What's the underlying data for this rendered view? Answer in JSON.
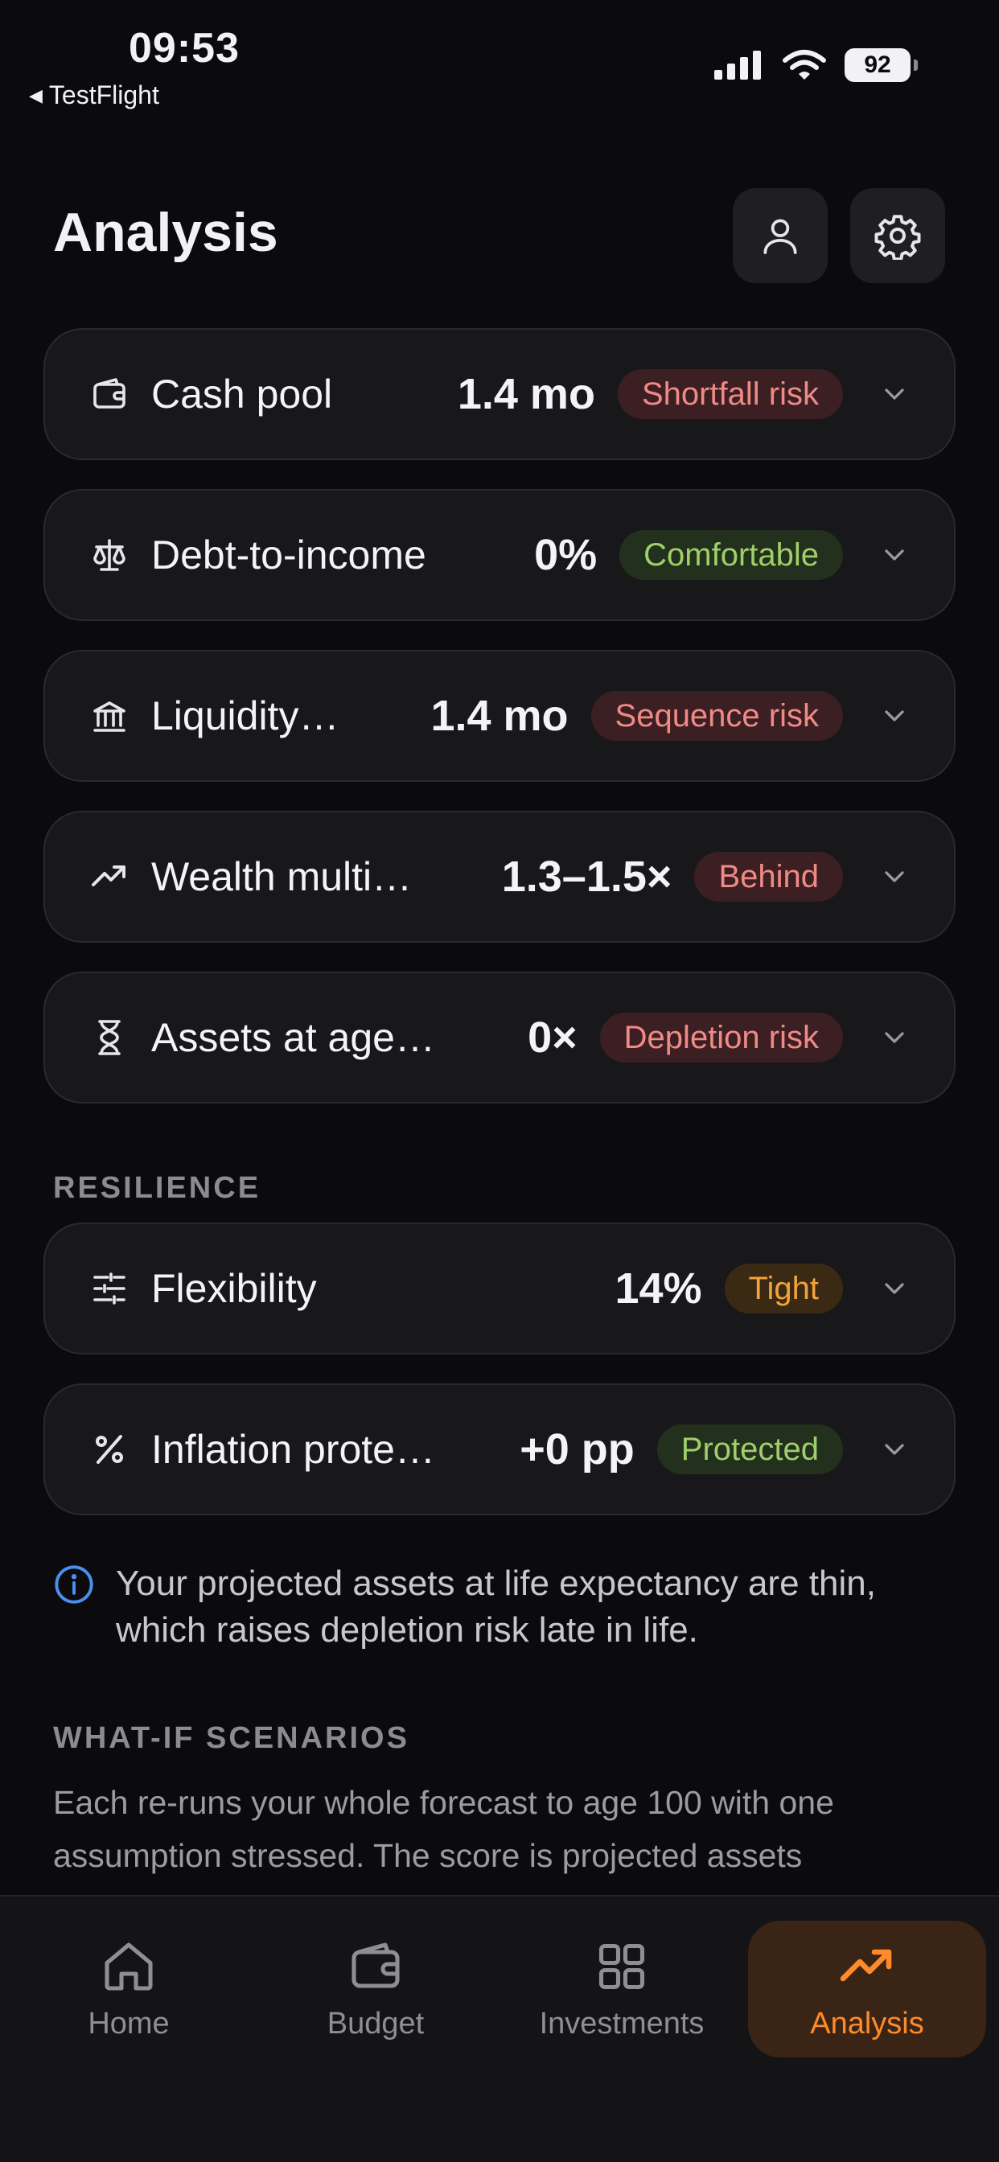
{
  "status_bar": {
    "time": "09:53",
    "back_app": "TestFlight",
    "battery": "92"
  },
  "header": {
    "title": "Analysis"
  },
  "metrics": [
    {
      "icon": "wallet-icon",
      "label": "Cash pool",
      "value": "1.4 mo",
      "status": "Shortfall risk",
      "tone": "red"
    },
    {
      "icon": "scale-icon",
      "label": "Debt-to-income",
      "value": "0%",
      "status": "Comfortable",
      "tone": "green"
    },
    {
      "icon": "bank-icon",
      "label": "Liquidity…",
      "value": "1.4 mo",
      "status": "Sequence risk",
      "tone": "red"
    },
    {
      "icon": "trend-up-icon",
      "label": "Wealth multi…",
      "value": "1.3–1.5×",
      "status": "Behind",
      "tone": "red"
    },
    {
      "icon": "hourglass-icon",
      "label": "Assets at age…",
      "value": "0×",
      "status": "Depletion risk",
      "tone": "red"
    }
  ],
  "resilience": {
    "section_label": "RESILIENCE",
    "items": [
      {
        "icon": "sliders-icon",
        "label": "Flexibility",
        "value": "14%",
        "status": "Tight",
        "tone": "amber"
      },
      {
        "icon": "percent-icon",
        "label": "Inflation prote…",
        "value": "+0 pp",
        "status": "Protected",
        "tone": "green"
      }
    ]
  },
  "info_note": "Your projected assets at life expectancy are thin, which raises depletion risk late in life.",
  "what_if": {
    "section_label": "WHAT-IF SCENARIOS",
    "description": "Each re-runs your whole forecast to age 100 with one assumption stressed. The score is projected assets"
  },
  "tabs": [
    {
      "label": "Home",
      "icon": "home-icon",
      "active": false
    },
    {
      "label": "Budget",
      "icon": "wallet-icon",
      "active": false
    },
    {
      "label": "Investments",
      "icon": "grid-icon",
      "active": false
    },
    {
      "label": "Analysis",
      "icon": "trend-up-icon",
      "active": true
    }
  ],
  "colors": {
    "background": "#0b0b0d",
    "card": "#18181a",
    "accent": "#ff8a2a",
    "risk": "#ef8a86",
    "good": "#9fcf6a",
    "warn": "#f2a33a",
    "info": "#4a8ff0"
  }
}
